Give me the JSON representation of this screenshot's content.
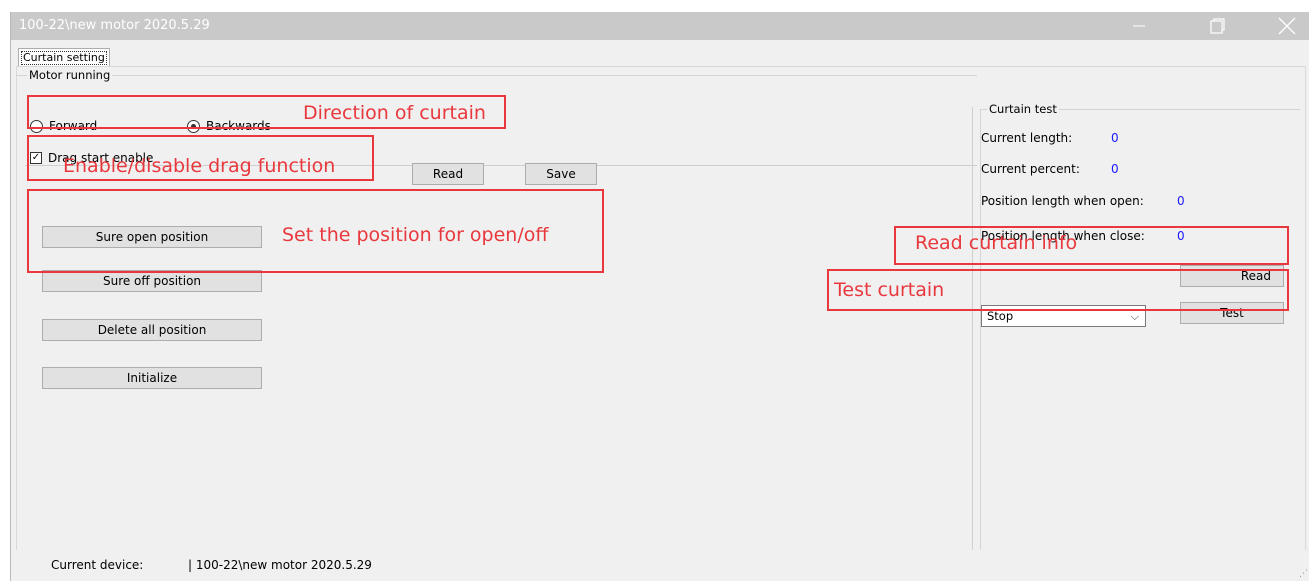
{
  "window": {
    "title": "100-22\\new motor 2020.5.29",
    "minimize_icon": "minimize-icon",
    "maximize_icon": "restore-icon",
    "close_icon": "close-icon"
  },
  "tabs": [
    {
      "label": "Curtain setting",
      "active": true
    }
  ],
  "motor_running": {
    "title": "Motor running",
    "forward_label": "Forward",
    "backwards_label": "Backwards",
    "selected": "Backwards",
    "drag_label": "Drag start enable",
    "drag_checked": true,
    "read_label": "Read",
    "save_label": "Save"
  },
  "position_buttons": {
    "sure_open": "Sure open position",
    "sure_off": "Sure off position",
    "delete_all": "Delete all position",
    "initialize": "Initialize"
  },
  "curtain_test": {
    "title": "Curtain test",
    "current_length_label": "Current length:",
    "current_length_value": "0",
    "current_percent_label": "Current percent:",
    "current_percent_value": "0",
    "open_length_label": "Position length when open:",
    "open_length_value": "0",
    "close_length_label": "Position length when close:",
    "close_length_value": "0",
    "read_label": "Read",
    "select_value": "Stop",
    "test_label": "Test"
  },
  "annotations": {
    "direction": "Direction of curtain",
    "drag": "Enable/disable drag function",
    "position": "Set the position for open/off",
    "read_info": "Read curtain info",
    "test": "Test curtain",
    "color": "#e8383d"
  },
  "status": {
    "label": "Current device:",
    "value": "| 100-22\\new motor 2020.5.29"
  }
}
